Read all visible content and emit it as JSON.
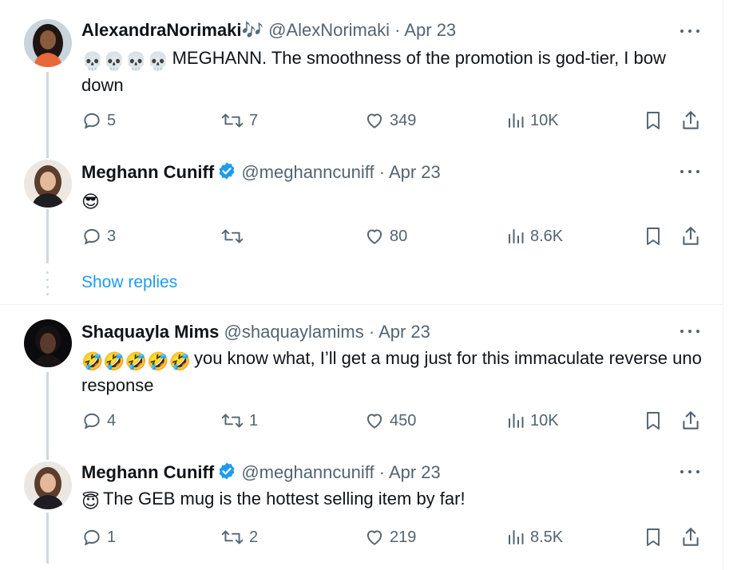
{
  "tweets": [
    {
      "name": "AlexandraNorimaki",
      "name_suffix": "🎶",
      "handle": "@AlexNorimaki",
      "date": "Apr 23",
      "verified": false,
      "emoji_prefix": "💀💀💀💀",
      "text": "MEGHANN. The smoothness of the promotion is god-tier, I bow down",
      "replies": "5",
      "retweets": "7",
      "likes": "349",
      "views": "10K"
    },
    {
      "name": "Meghann Cuniff",
      "handle": "@meghanncuniff",
      "date": "Apr 23",
      "verified": true,
      "emoji_prefix": "😎",
      "text": "",
      "replies": "3",
      "retweets": "",
      "likes": "80",
      "views": "8.6K"
    },
    {
      "name": "Shaquayla Mims",
      "handle": "@shaquaylamims",
      "date": "Apr 23",
      "verified": false,
      "emoji_prefix": "🤣🤣🤣🤣🤣",
      "text": "you know what, I’ll get a mug just for this immaculate reverse uno response",
      "replies": "4",
      "retweets": "1",
      "likes": "450",
      "views": "10K"
    },
    {
      "name": "Meghann Cuniff",
      "handle": "@meghanncuniff",
      "date": "Apr 23",
      "verified": true,
      "emoji_prefix": "😇",
      "text": "The GEB mug is the hottest selling item by far!",
      "replies": "1",
      "retweets": "2",
      "likes": "219",
      "views": "8.5K"
    }
  ],
  "show_replies_label": "Show replies",
  "separator_dot": "·",
  "colors": {
    "text": "#0f1419",
    "secondary": "#536471",
    "accent": "#1d9bf0",
    "thread_line": "#cfd9de"
  },
  "icons": [
    "reply-icon",
    "retweet-icon",
    "like-icon",
    "views-icon",
    "bookmark-icon",
    "share-icon",
    "more-icon",
    "verified-badge-icon"
  ]
}
